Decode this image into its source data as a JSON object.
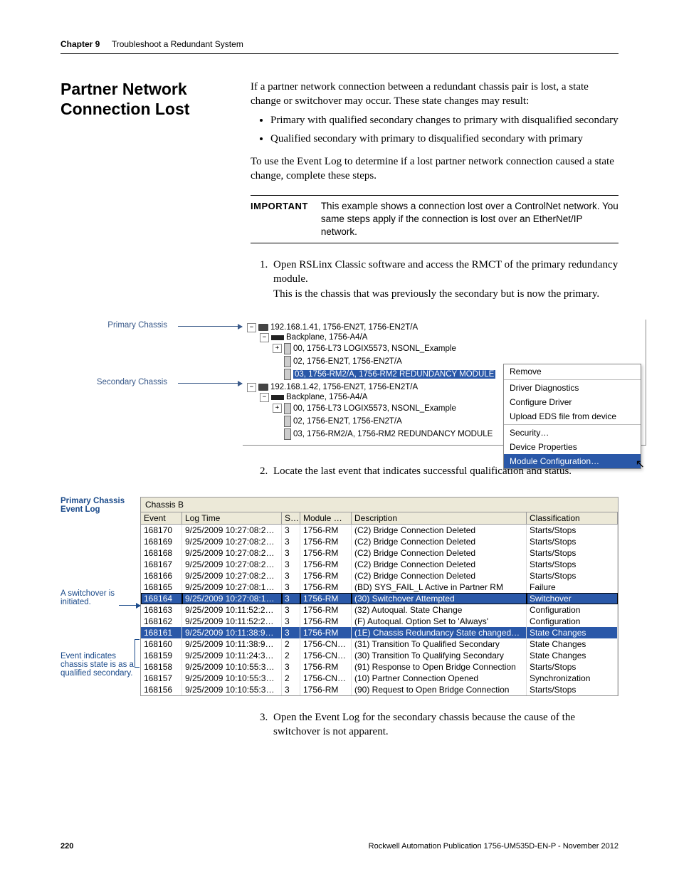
{
  "header": {
    "chapter": "Chapter 9",
    "title": "Troubleshoot a Redundant System"
  },
  "section_title": "Partner Network Connection Lost",
  "intro_p": "If a partner network connection between a redundant chassis pair is lost, a state change or switchover may occur. These state changes may result:",
  "bullets": [
    "Primary with qualified secondary changes to primary with disqualified secondary",
    "Qualified secondary with primary to disqualified secondary with primary"
  ],
  "step_intro": "To use the Event Log to determine if a lost partner network connection caused a state change, complete these steps.",
  "important": {
    "label": "IMPORTANT",
    "text": "This example shows a connection lost over a ControlNet network. You same steps apply if the connection is lost over an EtherNet/IP network."
  },
  "step1": {
    "text": "Open RSLinx Classic software and access the RMCT of the primary redundancy module.",
    "sub": "This is the chassis that was previously the secondary but is now the primary."
  },
  "tree": {
    "labels": {
      "primary": "Primary Chassis",
      "secondary": "Secondary Chassis"
    },
    "nodes": {
      "p_root": "192.168.1.41, 1756-EN2T, 1756-EN2T/A",
      "p_bp": "Backplane, 1756-A4/A",
      "p_0": "00, 1756-L73 LOGIX5573, NSONL_Example",
      "p_2": "02, 1756-EN2T, 1756-EN2T/A",
      "p_3": "03, 1756-RM2/A, 1756-RM2 REDUNDANCY MODULE",
      "s_root": "192.168.1.42, 1756-EN2T, 1756-EN2T/A",
      "s_bp": "Backplane, 1756-A4/A",
      "s_0": "00, 1756-L73 LOGIX5573, NSONL_Example",
      "s_2": "02, 1756-EN2T, 1756-EN2T/A",
      "s_3": "03, 1756-RM2/A, 1756-RM2 REDUNDANCY MODULE"
    },
    "ctx": {
      "remove": "Remove",
      "dd": "Driver Diagnostics",
      "cd": "Configure Driver",
      "ue": "Upload EDS file from device",
      "sec": "Security…",
      "dp": "Device Properties",
      "mc": "Module Configuration…"
    }
  },
  "step2": "Locate the last event that indicates successful qualification and status.",
  "eventlog": {
    "callouts": {
      "title": "Primary Chassis Event Log",
      "switch": "A switchover is initiated.",
      "qual": "Event indicates chassis state is as a qualified secondary."
    },
    "chassis_label": "Chassis B",
    "headers": {
      "event": "Event",
      "logtime": "Log Time",
      "s": "S…",
      "module": "Module …",
      "desc": "Description",
      "class": "Classification"
    },
    "rows": [
      {
        "e": "168170",
        "t": "9/25/2009 10:27:08:2…",
        "s": "3",
        "m": "1756-RM",
        "d": "(C2) Bridge Connection Deleted",
        "c": "Starts/Stops",
        "hl": ""
      },
      {
        "e": "168169",
        "t": "9/25/2009 10:27:08:2…",
        "s": "3",
        "m": "1756-RM",
        "d": "(C2) Bridge Connection Deleted",
        "c": "Starts/Stops",
        "hl": ""
      },
      {
        "e": "168168",
        "t": "9/25/2009 10:27:08:2…",
        "s": "3",
        "m": "1756-RM",
        "d": "(C2) Bridge Connection Deleted",
        "c": "Starts/Stops",
        "hl": ""
      },
      {
        "e": "168167",
        "t": "9/25/2009 10:27:08:2…",
        "s": "3",
        "m": "1756-RM",
        "d": "(C2) Bridge Connection Deleted",
        "c": "Starts/Stops",
        "hl": ""
      },
      {
        "e": "168166",
        "t": "9/25/2009 10:27:08:2…",
        "s": "3",
        "m": "1756-RM",
        "d": "(C2) Bridge Connection Deleted",
        "c": "Starts/Stops",
        "hl": ""
      },
      {
        "e": "168165",
        "t": "9/25/2009 10:27:08:1…",
        "s": "3",
        "m": "1756-RM",
        "d": "(BD) SYS_FAIL_L Active in Partner RM",
        "c": "Failure",
        "hl": ""
      },
      {
        "e": "168164",
        "t": "9/25/2009 10:27:08:1…",
        "s": "3",
        "m": "1756-RM",
        "d": "(30) Switchover Attempted",
        "c": "Switchover",
        "hl": "blue box"
      },
      {
        "e": "168163",
        "t": "9/25/2009 10:11:52:2…",
        "s": "3",
        "m": "1756-RM",
        "d": "(32) Autoqual. State Change",
        "c": "Configuration",
        "hl": ""
      },
      {
        "e": "168162",
        "t": "9/25/2009 10:11:52:2…",
        "s": "3",
        "m": "1756-RM",
        "d": "(F) Autoqual. Option Set to 'Always'",
        "c": "Configuration",
        "hl": ""
      },
      {
        "e": "168161",
        "t": "9/25/2009 10:11:38:9…",
        "s": "3",
        "m": "1756-RM",
        "d": "(1E) Chassis Redundancy State changed…",
        "c": "State Changes",
        "hl": "blue"
      },
      {
        "e": "168160",
        "t": "9/25/2009 10:11:38:9…",
        "s": "2",
        "m": "1756-CN…",
        "d": "(31) Transition To Qualified Secondary",
        "c": "State Changes",
        "hl": ""
      },
      {
        "e": "168159",
        "t": "9/25/2009 10:11:24:3…",
        "s": "2",
        "m": "1756-CN…",
        "d": "(30) Transition To Qualifying Secondary",
        "c": "State Changes",
        "hl": ""
      },
      {
        "e": "168158",
        "t": "9/25/2009 10:10:55:3…",
        "s": "3",
        "m": "1756-RM",
        "d": "(91) Response to Open Bridge Connection",
        "c": "Starts/Stops",
        "hl": ""
      },
      {
        "e": "168157",
        "t": "9/25/2009 10:10:55:3…",
        "s": "2",
        "m": "1756-CN…",
        "d": "(10) Partner Connection Opened",
        "c": "Synchronization",
        "hl": ""
      },
      {
        "e": "168156",
        "t": "9/25/2009 10:10:55:3…",
        "s": "3",
        "m": "1756-RM",
        "d": "(90) Request to Open Bridge Connection",
        "c": "Starts/Stops",
        "hl": ""
      }
    ]
  },
  "step3": "Open the Event Log for the secondary chassis because the cause of the switchover is not apparent.",
  "footer": {
    "page": "220",
    "pub": "Rockwell Automation Publication 1756-UM535D-EN-P - November 2012"
  }
}
